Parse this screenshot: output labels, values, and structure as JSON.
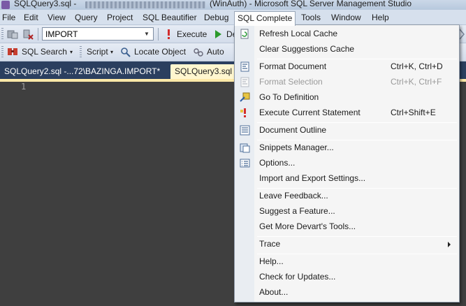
{
  "window": {
    "title_left": "SQLQuery3.sql - ",
    "title_right": "(WinAuth) - Microsoft SQL Server Management Studio"
  },
  "menubar": {
    "items": [
      {
        "label": "File"
      },
      {
        "label": "Edit"
      },
      {
        "label": "View"
      },
      {
        "label": "Query"
      },
      {
        "label": "Project"
      },
      {
        "label": "SQL Beautifier"
      },
      {
        "label": "Debug"
      },
      {
        "label": "SQL Complete"
      },
      {
        "label": "Tools"
      },
      {
        "label": "Window"
      },
      {
        "label": "Help"
      }
    ]
  },
  "toolbar1": {
    "database": "IMPORT",
    "execute_label": "Execute",
    "debug_label_partial": "De"
  },
  "toolbar2": {
    "sql_search_label": "SQL Search",
    "script_label": "Script",
    "locate_object_label": "Locate Object",
    "auto_label": "Auto"
  },
  "tabs": [
    {
      "label": "SQLQuery2.sql -...72\\BAZINGA.IMPORT*"
    },
    {
      "label": "SQLQuery3.sql -"
    }
  ],
  "editor": {
    "line_number": "1"
  },
  "dropdown": {
    "items": [
      {
        "label": "Refresh Local Cache",
        "shortcut": "",
        "icon": "refresh-cache-icon",
        "enabled": true
      },
      {
        "label": "Clear Suggestions Cache",
        "shortcut": "",
        "icon": "",
        "enabled": true
      },
      {
        "label": "Format Document",
        "shortcut": "Ctrl+K, Ctrl+D",
        "icon": "format-document-icon",
        "enabled": true
      },
      {
        "label": "Format Selection",
        "shortcut": "Ctrl+K, Ctrl+F",
        "icon": "format-selection-icon",
        "enabled": false
      },
      {
        "label": "Go To Definition",
        "shortcut": "",
        "icon": "go-to-definition-icon",
        "enabled": true
      },
      {
        "label": "Execute Current Statement",
        "shortcut": "Ctrl+Shift+E",
        "icon": "execute-statement-icon",
        "enabled": true
      },
      {
        "label": "Document Outline",
        "shortcut": "",
        "icon": "document-outline-icon",
        "enabled": true
      },
      {
        "label": "Snippets Manager...",
        "shortcut": "",
        "icon": "snippets-manager-icon",
        "enabled": true
      },
      {
        "label": "Options...",
        "shortcut": "",
        "icon": "options-icon",
        "enabled": true
      },
      {
        "label": "Import and Export Settings...",
        "shortcut": "",
        "icon": "",
        "enabled": true
      },
      {
        "label": "Leave Feedback...",
        "shortcut": "",
        "icon": "",
        "enabled": true
      },
      {
        "label": "Suggest a Feature...",
        "shortcut": "",
        "icon": "",
        "enabled": true
      },
      {
        "label": "Get More Devart's Tools...",
        "shortcut": "",
        "icon": "",
        "enabled": true
      },
      {
        "label": "Trace",
        "shortcut": "",
        "icon": "",
        "enabled": true
      },
      {
        "label": "Help...",
        "shortcut": "",
        "icon": "",
        "enabled": true
      },
      {
        "label": "Check for Updates...",
        "shortcut": "",
        "icon": "",
        "enabled": true
      },
      {
        "label": "About...",
        "shortcut": "",
        "icon": "",
        "enabled": true
      }
    ]
  },
  "colors": {
    "editor_background": "#3f3f3f",
    "tab_strip": "#2b3f5f",
    "active_tab": "#fff6cf",
    "menu_background": "#f5f5f5",
    "menubar_background": "#d6e0ed"
  }
}
